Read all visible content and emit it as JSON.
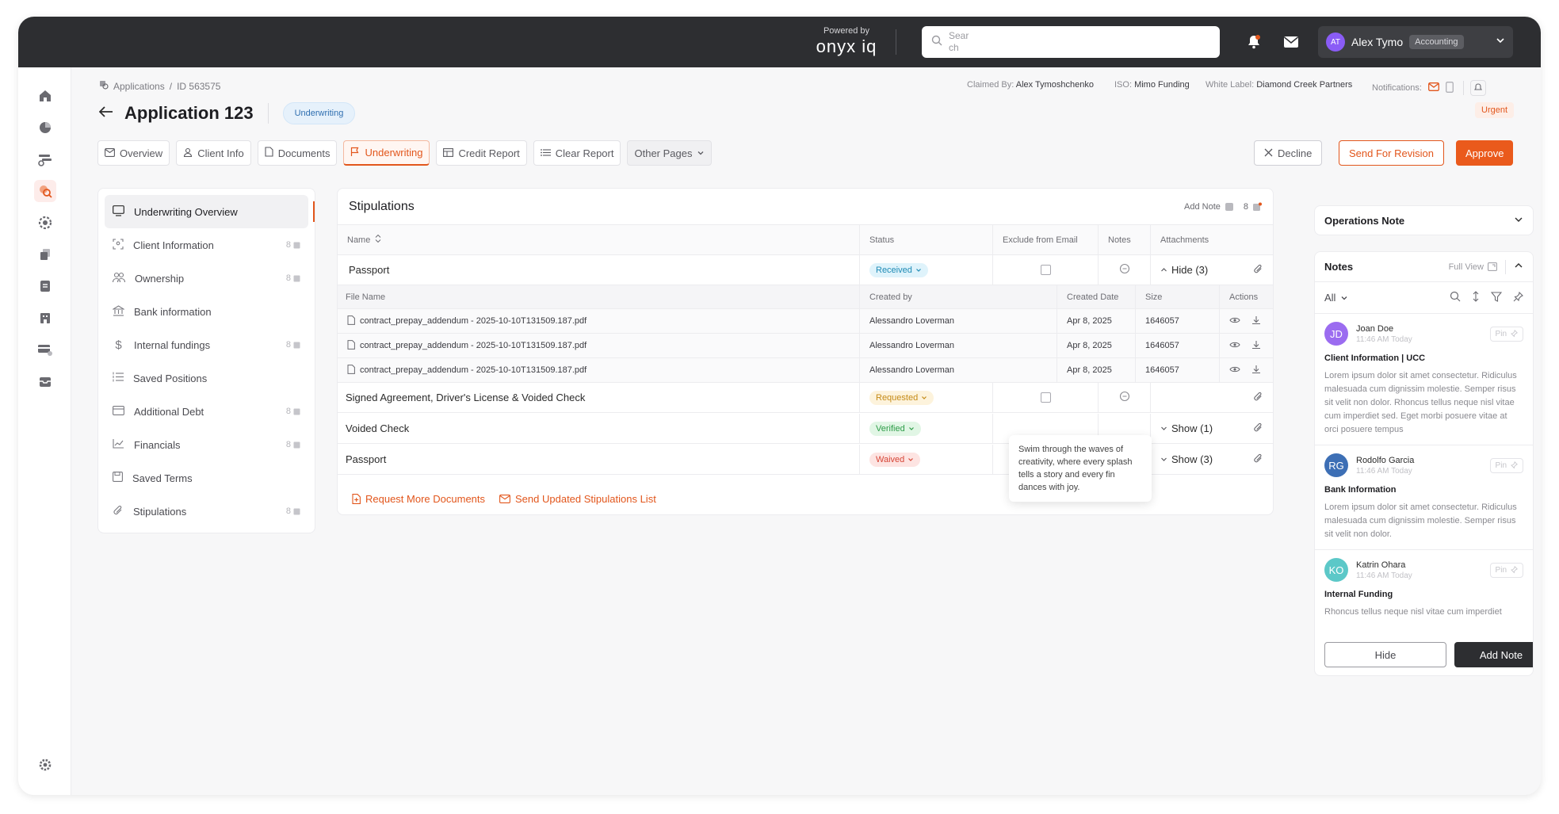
{
  "topbar": {
    "powered_small": "Powered by",
    "powered_brand": "onyx iq",
    "search_placeholder": "Search",
    "notification_dot_color": "#e2561c",
    "user": {
      "initials": "AT",
      "name": "Alex Tymo",
      "role": "Accounting"
    }
  },
  "rail": {
    "items": [
      "home-icon",
      "chart-pie-icon",
      "pipeline-icon",
      "underwriting-search-icon",
      "settings-gear-icon",
      "documents-icon",
      "notes-icon",
      "building-icon",
      "payments-card-icon",
      "inbox-icon"
    ],
    "bottom": "settings-icon"
  },
  "breadcrumb": {
    "root": "Applications",
    "sep": "/",
    "current": "ID 563575"
  },
  "header": {
    "title": "Application 123",
    "stage": "Underwriting",
    "claimed_label": "Claimed By:",
    "claimed_value": "Alex Tymoshchenko",
    "iso_label": "ISO:",
    "iso_value": "Mimo Funding",
    "wl_label": "White Label:",
    "wl_value": "Diamond Creek Partners",
    "notif_label": "Notifications:",
    "urgent": "Urgent"
  },
  "tabs": [
    {
      "label": "Overview"
    },
    {
      "label": "Client Info"
    },
    {
      "label": "Documents"
    },
    {
      "label": "Underwriting"
    },
    {
      "label": "Credit Report"
    },
    {
      "label": "Clear Report"
    },
    {
      "label": "Other Pages"
    }
  ],
  "actions": {
    "decline": "Decline",
    "revision": "Send For Revision",
    "approve": "Approve"
  },
  "side_menu": [
    {
      "label": "Underwriting Overview",
      "count": ""
    },
    {
      "label": "Client Information",
      "count": "8"
    },
    {
      "label": "Ownership",
      "count": "8"
    },
    {
      "label": "Bank information",
      "count": ""
    },
    {
      "label": "Internal fundings",
      "count": "8"
    },
    {
      "label": "Saved Positions",
      "count": ""
    },
    {
      "label": "Additional Debt",
      "count": "8"
    },
    {
      "label": "Financials",
      "count": "8"
    },
    {
      "label": "Saved Terms",
      "count": ""
    },
    {
      "label": "Stipulations",
      "count": "8"
    }
  ],
  "stipulations": {
    "title": "Stipulations",
    "add_note": "Add Note",
    "note_count": "8",
    "columns": {
      "name": "Name",
      "status": "Status",
      "exclude": "Exclude from Email",
      "notes": "Notes",
      "attachments": "Attachments"
    },
    "file_columns": {
      "file_name": "File Name",
      "created_by": "Created by",
      "created_date": "Created Date",
      "size": "Size",
      "actions": "Actions"
    },
    "rows": [
      {
        "name": "Passport",
        "status": "Received",
        "toggle": "Hide (3)"
      },
      {
        "name": "Signed Agreement, Driver's License & Voided Check",
        "status": "Requested",
        "toggle": ""
      },
      {
        "name": "Voided Check",
        "status": "Verified",
        "toggle": "Show (1)"
      },
      {
        "name": "Passport",
        "status": "Waived",
        "toggle": "Show (3)"
      }
    ],
    "files": [
      {
        "name": "contract_prepay_addendum - 2025-10-10T131509.187.pdf",
        "created_by": "Alessandro Loverman",
        "date": "Apr 8, 2025",
        "size": "1646057"
      },
      {
        "name": "contract_prepay_addendum - 2025-10-10T131509.187.pdf",
        "created_by": "Alessandro Loverman",
        "date": "Apr 8, 2025",
        "size": "1646057"
      },
      {
        "name": "contract_prepay_addendum - 2025-10-10T131509.187.pdf",
        "created_by": "Alessandro Loverman",
        "date": "Apr 8, 2025",
        "size": "1646057"
      }
    ],
    "request_more": "Request More Documents",
    "send_updated": "Send Updated Stipulations List",
    "tooltip": "Swim through the waves of creativity, where every splash tells a story and every fin dances with joy."
  },
  "operations_note": {
    "title": "Operations Note"
  },
  "notes": {
    "title": "Notes",
    "full_view": "Full View",
    "filter": "All",
    "pin": "Pin",
    "items": [
      {
        "initials": "JD",
        "color": "#9b6cf0",
        "name": "Joan Doe",
        "time": "11:46 AM Today",
        "title": "Client Information | UCC",
        "body": "Lorem ipsum dolor sit amet consectetur. Ridiculus malesuada cum dignissim molestie. Semper risus sit velit non dolor. Rhoncus tellus neque nisl vitae cum imperdiet sed. Eget morbi posuere vitae at orci posuere tempus"
      },
      {
        "initials": "RG",
        "color": "#3d6fb5",
        "name": "Rodolfo Garcia",
        "time": "11:46 AM Today",
        "title": "Bank Information",
        "body": "Lorem ipsum dolor sit amet consectetur. Ridiculus malesuada cum dignissim molestie. Semper risus sit velit non dolor."
      },
      {
        "initials": "KO",
        "color": "#5cc8c8",
        "name": "Katrin Ohara",
        "time": "11:46 AM Today",
        "title": "Internal Funding",
        "body": "Rhoncus tellus neque nisl vitae cum imperdiet"
      }
    ],
    "hide": "Hide",
    "add_note": "Add Note"
  }
}
